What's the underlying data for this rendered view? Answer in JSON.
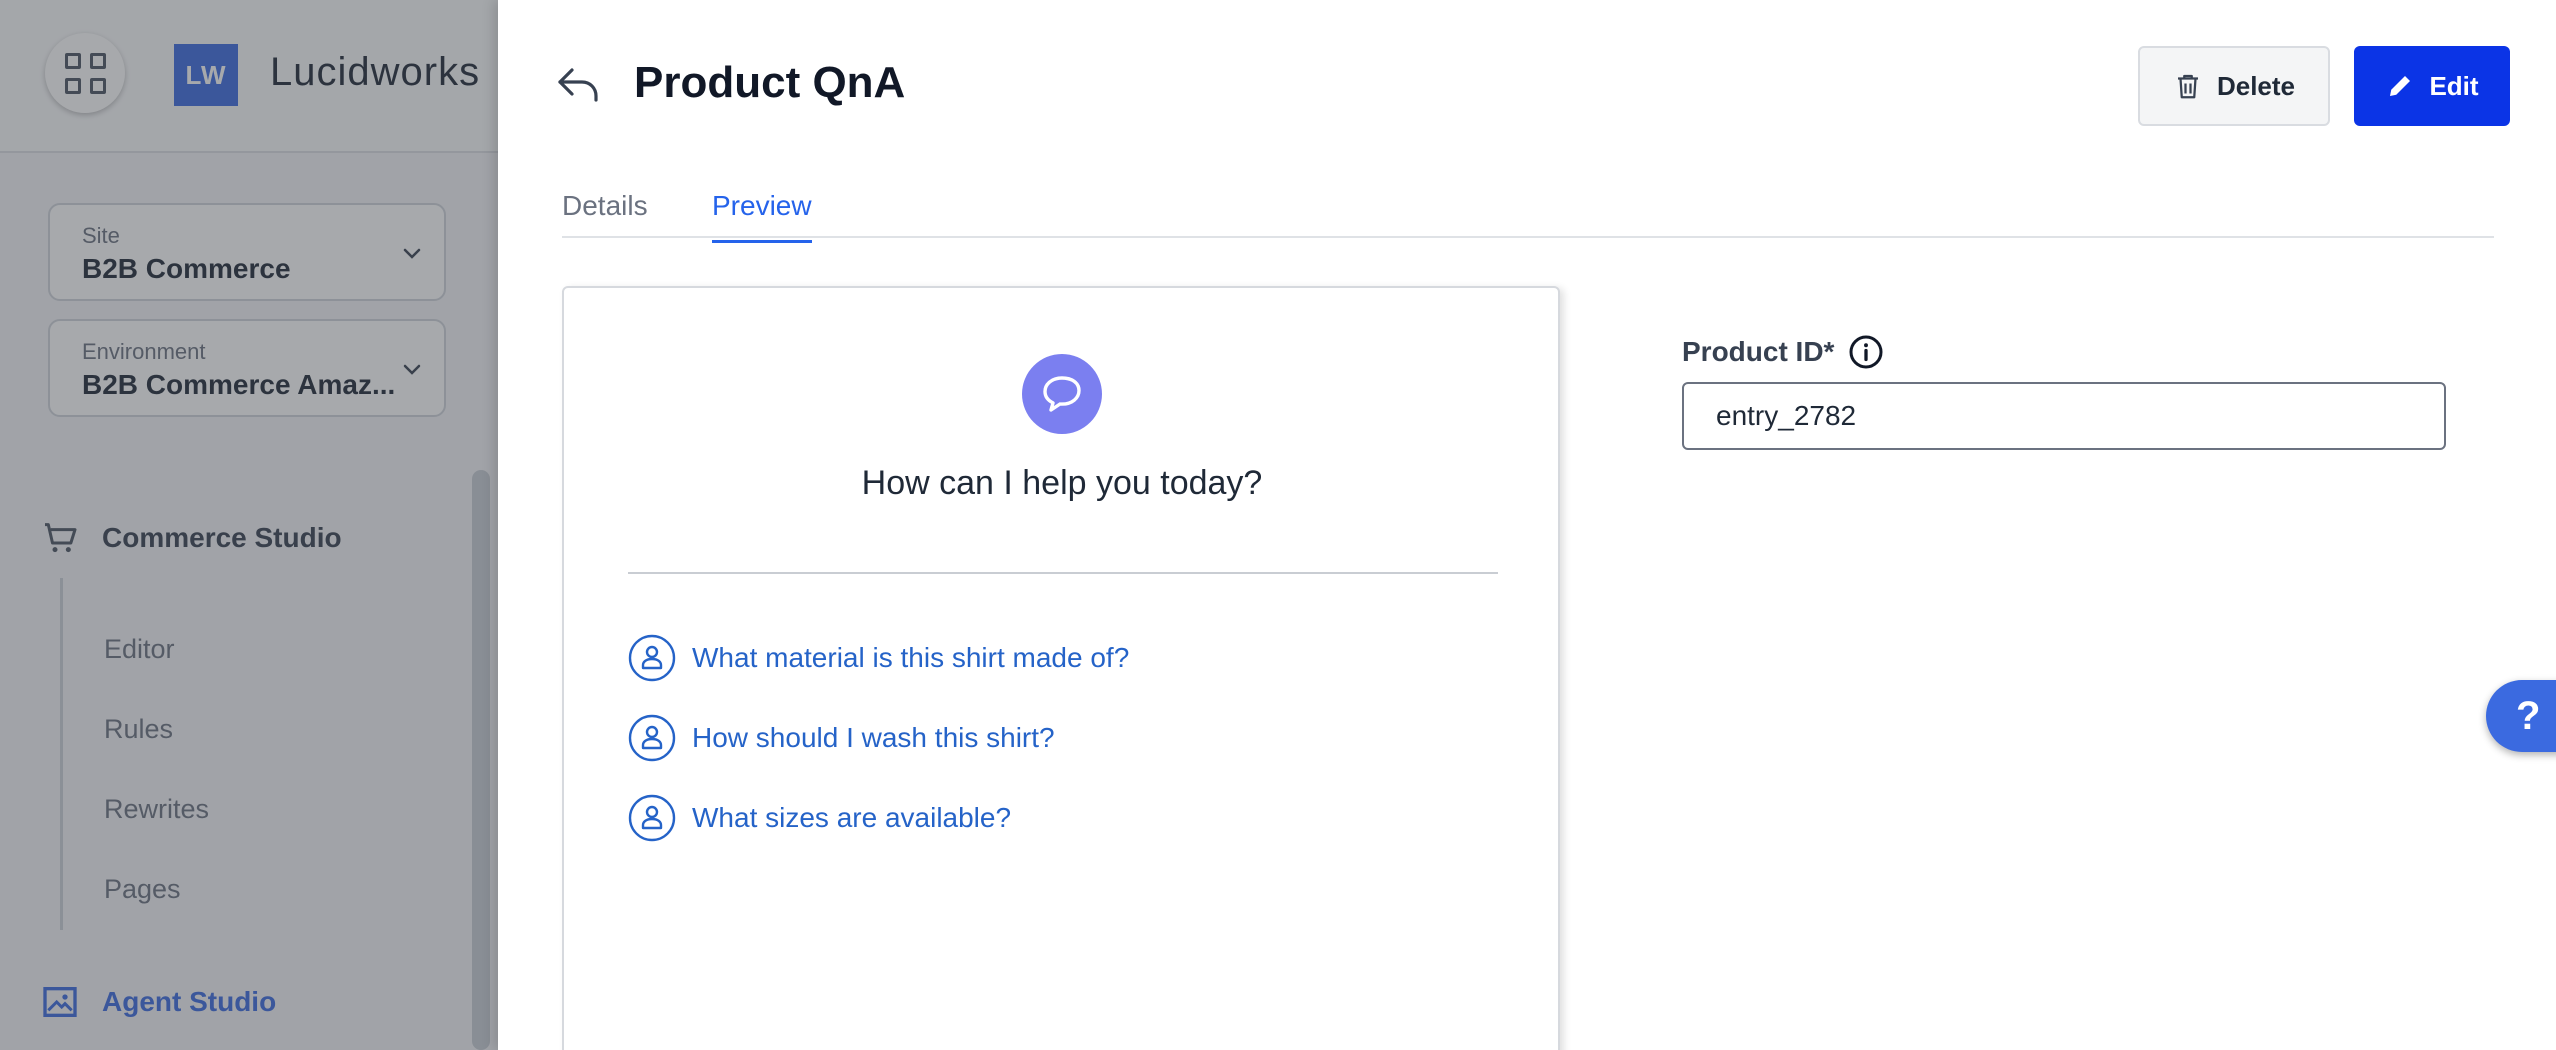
{
  "app": {
    "logo_text": "LW",
    "brand_name": "Lucidworks"
  },
  "sidebar": {
    "site": {
      "label": "Site",
      "value": "B2B Commerce"
    },
    "environment": {
      "label": "Environment",
      "value": "B2B Commerce Amaz..."
    },
    "sections": [
      {
        "label": "Commerce Studio",
        "icon": "cart-icon",
        "items": [
          "Editor",
          "Rules",
          "Rewrites",
          "Pages"
        ]
      },
      {
        "label": "Agent Studio",
        "icon": "image-icon"
      }
    ]
  },
  "panel": {
    "title": "Product QnA",
    "delete_label": "Delete",
    "edit_label": "Edit",
    "tabs": [
      {
        "label": "Details",
        "active": false
      },
      {
        "label": "Preview",
        "active": true
      }
    ],
    "chat": {
      "welcome": "How can I help you today?",
      "suggestions": [
        "What material is this shirt made of?",
        "How should I wash this shirt?",
        "What sizes are available?"
      ]
    },
    "product_id": {
      "label": "Product ID*",
      "value": "entry_2782"
    }
  },
  "help_fab_label": "?",
  "colors": {
    "primary": "#0b34e6",
    "accent": "#2563eb",
    "chat_icon_bg": "#7b7ff0",
    "logo_bg": "#3b6ae0"
  }
}
